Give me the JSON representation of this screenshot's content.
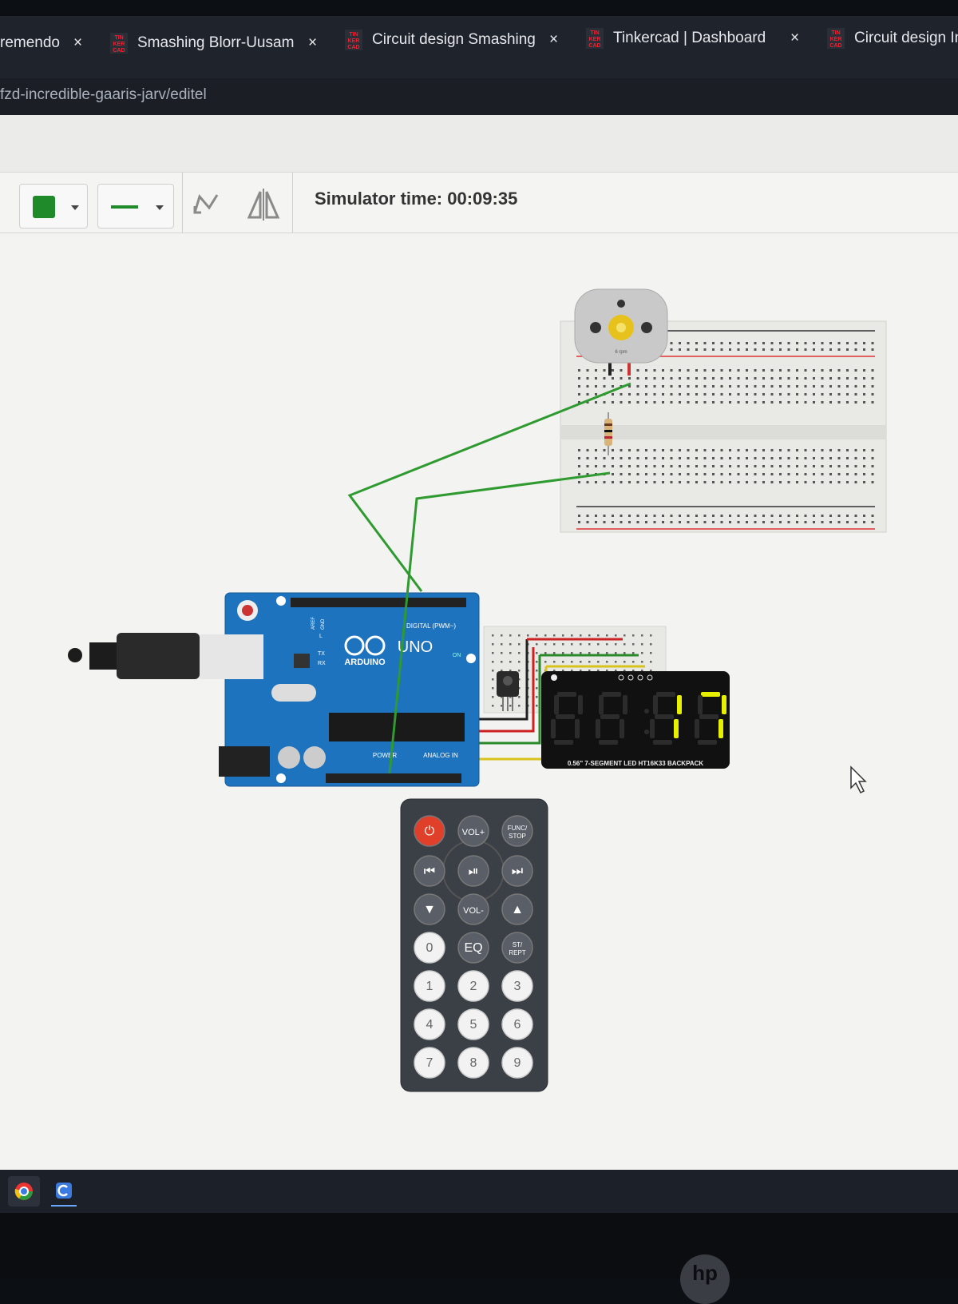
{
  "browser": {
    "tabs": [
      {
        "title": "remendo",
        "close": "×"
      },
      {
        "title": "Smashing Blorr-Uusam",
        "close": "×"
      },
      {
        "title": "Circuit design Smashing",
        "close": "×"
      },
      {
        "title": "Tinkercad | Dashboard",
        "close": "×"
      },
      {
        "title": "Circuit design In",
        "close": ""
      }
    ],
    "favicon_text": [
      "TIN",
      "KER",
      "CAD"
    ],
    "url": "fzd-incredible-gaaris-jarv/editel"
  },
  "toolbar": {
    "fill_color": "#1e8a2a",
    "line_style": "solid",
    "simulator_time": "Simulator time: 00:09:35"
  },
  "circuit": {
    "arduino": {
      "brand": "ARDUINO",
      "model": "UNO",
      "header_label": "DIGITAL (PWM~)",
      "power_label": "POWER",
      "analog_label": "ANALOG IN",
      "on_label": "ON",
      "tx_label": "TX",
      "rx_label": "RX",
      "l_label": "L",
      "aref_label": "AREF",
      "gnd_label": "GND"
    },
    "motor_label": "6 rpm",
    "display": {
      "digits": [
        "8",
        "8",
        "1",
        "7"
      ],
      "lit_digits": [
        false,
        false,
        true,
        true
      ],
      "label": "0.56\" 7-SEGMENT LED HT16K33 BACKPACK",
      "color": "#e6f000"
    },
    "remote": {
      "buttons": [
        [
          "⏻",
          "VOL+",
          "FUNC/ STOP"
        ],
        [
          "⏮",
          "⏯",
          "⏭"
        ],
        [
          "▼",
          "VOL-",
          "▲"
        ],
        [
          "0",
          "EQ",
          "ST/ REPT"
        ],
        [
          "1",
          "2",
          "3"
        ],
        [
          "4",
          "5",
          "6"
        ],
        [
          "7",
          "8",
          "9"
        ]
      ]
    },
    "wire_color": "#2f9a2f"
  },
  "monitor": {
    "brand": "hp"
  }
}
